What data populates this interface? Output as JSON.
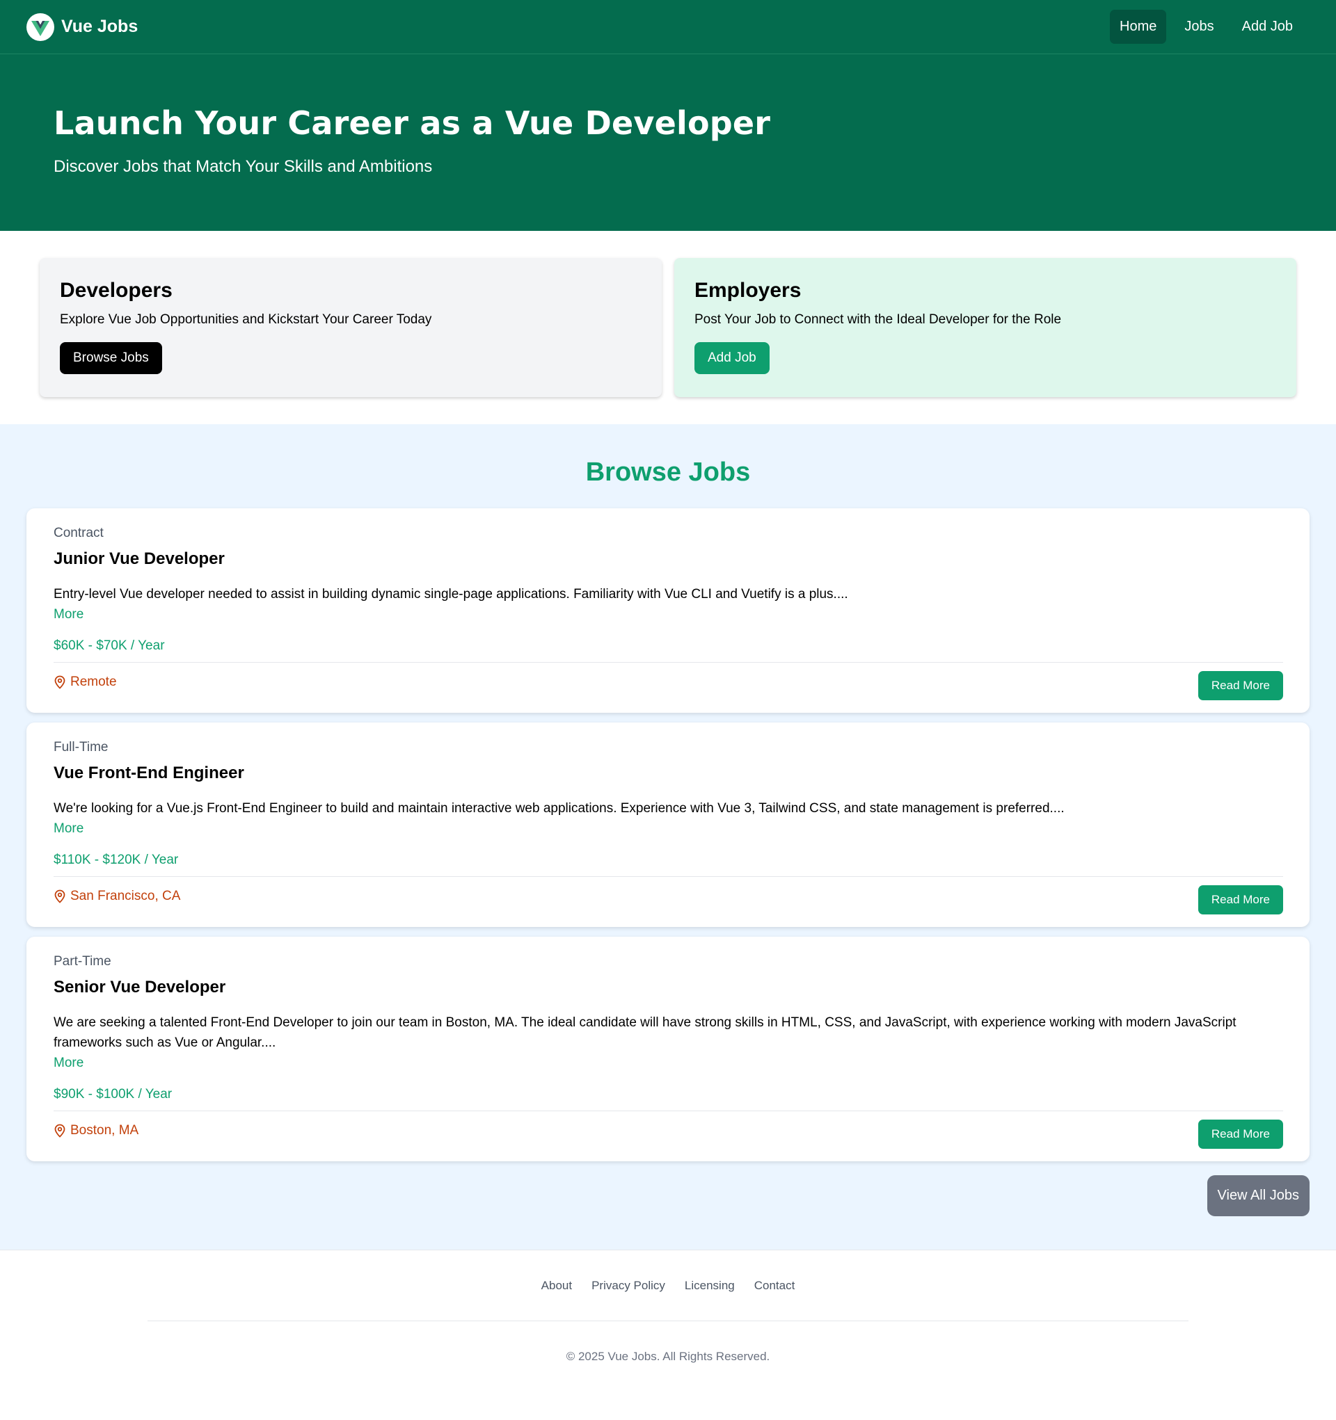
{
  "nav": {
    "brand": "Vue Jobs",
    "links": [
      "Home",
      "Jobs",
      "Add Job"
    ]
  },
  "hero": {
    "title": "Launch Your Career as a Vue Developer",
    "subtitle": "Discover Jobs that Match Your Skills and Ambitions"
  },
  "cards": {
    "developers": {
      "title": "Developers",
      "text": "Explore Vue Job Opportunities and Kickstart Your Career Today",
      "button": "Browse Jobs"
    },
    "employers": {
      "title": "Employers",
      "text": "Post Your Job to Connect with the Ideal Developer for the Role",
      "button": "Add Job"
    }
  },
  "jobs": {
    "heading": "Browse Jobs",
    "list": [
      {
        "type": "Contract",
        "title": "Junior Vue Developer",
        "description": "Entry-level Vue developer needed to assist in building dynamic single-page applications. Familiarity with Vue CLI and Vuetify is a plus....",
        "more": "More",
        "salary": "$60K - $70K / Year",
        "location": "Remote",
        "button": "Read More"
      },
      {
        "type": "Full-Time",
        "title": "Vue Front-End Engineer",
        "description": "We're looking for a Vue.js Front-End Engineer to build and maintain interactive web applications. Experience with Vue 3, Tailwind CSS, and state management is preferred....",
        "more": "More",
        "salary": "$110K - $120K / Year",
        "location": "San Francisco, CA",
        "button": "Read More"
      },
      {
        "type": "Part-Time",
        "title": "Senior Vue Developer",
        "description": "We are seeking a talented Front-End Developer to join our team in Boston, MA. The ideal candidate will have strong skills in HTML, CSS, and JavaScript, with experience working with modern JavaScript frameworks such as Vue or Angular....",
        "more": "More",
        "salary": "$90K - $100K / Year",
        "location": "Boston, MA",
        "button": "Read More"
      }
    ],
    "view_all": "View All Jobs"
  },
  "footer": {
    "links": [
      "About",
      "Privacy Policy",
      "Licensing",
      "Contact"
    ],
    "copyright": "© 2025 Vue Jobs. All Rights Reserved."
  },
  "colors": {
    "brand": "#046c4e",
    "accent": "#0e9f6e",
    "location": "#c2410c"
  }
}
